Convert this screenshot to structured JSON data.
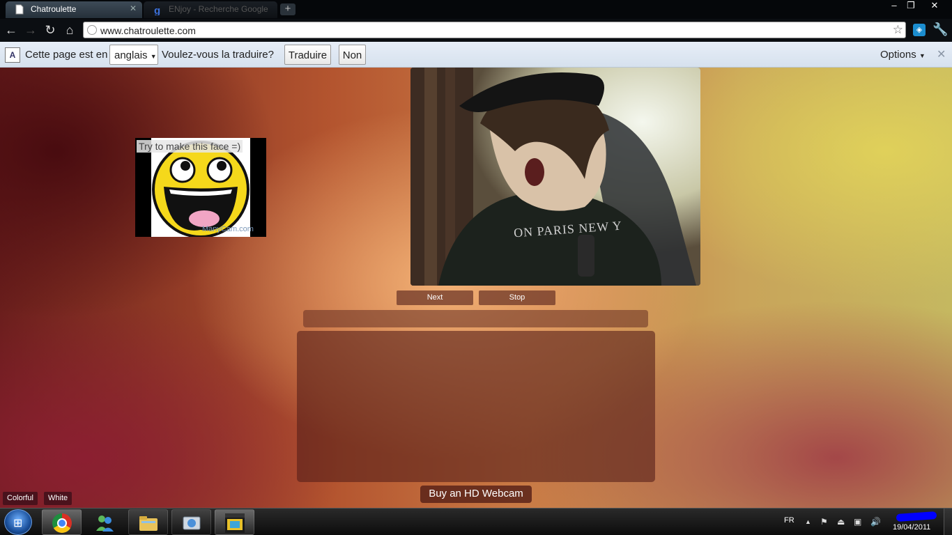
{
  "browser": {
    "tabs": [
      {
        "title": "Chatroulette",
        "active": true
      },
      {
        "title": "ENjoy - Recherche Google",
        "active": false
      }
    ],
    "address": "www.chatroulette.com"
  },
  "translate_bar": {
    "prefix": "Cette page est en",
    "language": "anglais",
    "question": "Voulez-vous la traduire?",
    "translate_label": "Traduire",
    "no_label": "Non",
    "options_label": "Options"
  },
  "page": {
    "self_video_caption": "Try to make this face =)",
    "self_video_watermark": "ManyCam.com",
    "shirt_text": "ON PARIS NEW Y",
    "next_label": "Next",
    "stop_label": "Stop",
    "buy_label": "Buy an HD Webcam",
    "theme_colorful": "Colorful",
    "theme_white": "White"
  },
  "taskbar": {
    "language": "FR",
    "date": "19/04/2011",
    "apps": [
      "chrome",
      "messenger",
      "explorer",
      "photo-viewer",
      "movie-studio"
    ]
  },
  "colors": {
    "chrome_dark": "#05070a",
    "translate_bar": "#e7eef7",
    "button_brown": "#6e3728"
  }
}
